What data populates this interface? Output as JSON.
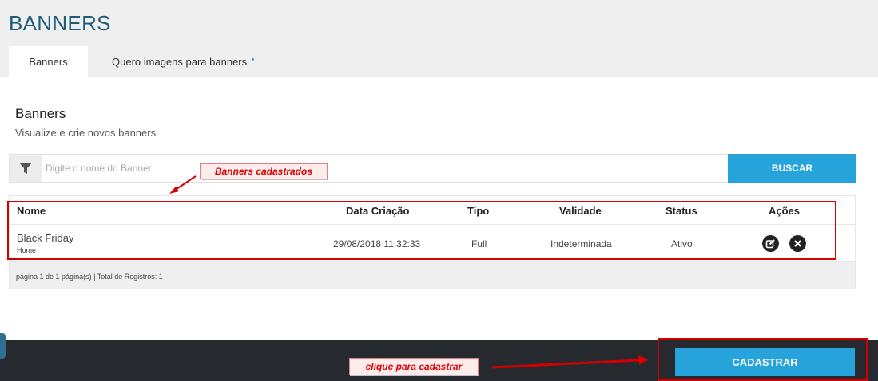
{
  "header": {
    "page_title": "BANNERS",
    "tabs": [
      {
        "label": "Banners",
        "active": true
      },
      {
        "label": "Quero imagens para banners",
        "active": false
      }
    ]
  },
  "section": {
    "title": "Banners",
    "subtitle": "Visualize e crie novos banners"
  },
  "search": {
    "placeholder": "Digite o nome do Banner",
    "value": "",
    "button_label": "BUSCAR",
    "filter_icon": "filter-icon"
  },
  "table": {
    "columns": [
      "Nome",
      "Data Criação",
      "Tipo",
      "Validade",
      "Status",
      "Ações"
    ],
    "rows": [
      {
        "name": "Black Friday",
        "location": "Home",
        "created": "29/08/2018 11:32:33",
        "type": "Full",
        "validity": "Indeterminada",
        "status": "Ativo",
        "actions": [
          "edit-icon",
          "delete-icon"
        ]
      }
    ],
    "pagination": "página 1 de 1 página(s) | Total de Registros: 1"
  },
  "annotations": {
    "banners_callout": "Banners cadastrados",
    "cadastrar_callout": "clique para cadastrar",
    "highlight_color": "#d40000"
  },
  "bottom_bar": {
    "cadastrar_label": "CADASTRAR"
  },
  "colors": {
    "accent": "#27a3dc",
    "title": "#1f5a7a",
    "bar": "#262a2f"
  }
}
